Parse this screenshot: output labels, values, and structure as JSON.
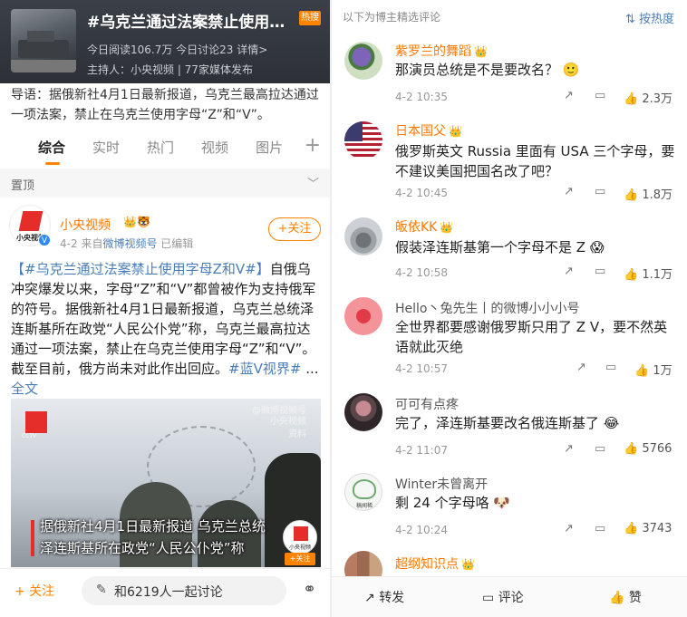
{
  "topic": {
    "title": "#乌克兰通过法案禁止使用字母Z和V#",
    "hot_badge": "热搜",
    "stats": "今日阅读106.7万  今日讨论23  详情>",
    "host": "主持人：小央视频 | 77家媒体发布",
    "intro": "导语：据俄新社4月1日最新报道，乌克兰最高拉达通过一项法案，禁止在乌克兰使用字母“Z”和“V”。"
  },
  "tabs": [
    "综合",
    "实时",
    "热门",
    "视频",
    "图片"
  ],
  "tab_plus": "+",
  "pinned": {
    "label": "置顶",
    "chevron": "﹀"
  },
  "post": {
    "author": "小央视频",
    "author_badges": "👑🐯",
    "avatar_text": "小央视频",
    "verified": "V",
    "date": "4-2",
    "source_prefix": "来自",
    "source": "微博视频号",
    "edited": "已编辑",
    "follow_label": "+关注",
    "hashtag": "【#乌克兰通过法案禁止使用字母Z和V#】",
    "body": "自俄乌冲突爆发以来，字母“Z”和“V”都曾被作为支持俄军的符号。据俄新社4月1日最新报道，乌克兰总统泽连斯基所在政党“人民公仆党”称，乌克兰最高拉达通过一项法案，禁止在乌克兰使用字母“Z”和“V”。截至目前，俄方尚未对此作出回应。",
    "hashtag2": "#蓝V视界#",
    "ellipsis": " ... ",
    "full_text": "全文"
  },
  "video": {
    "logo_text": "CCTV",
    "watermark": "@微博视频号\n小央视频",
    "watermark2": "资料",
    "subtitle_line1": "据俄新社4月1日最新报道 乌克兰总统",
    "subtitle_line2": "泽连斯基所在政党“人民公仆党”称",
    "avatar_text": "小央视频",
    "follow": "+关注"
  },
  "bottom_bar": {
    "follow": "+ 关注",
    "input_icon": "✎",
    "input_text": "和6219人一起讨论",
    "share_icon": "⚭"
  },
  "comments_header": {
    "label": "以下为博主精选评论",
    "sort": "⇅ 按热度"
  },
  "comments": [
    {
      "name": "紫罗兰的舞蹈",
      "crown": "👑",
      "text": "那演员总统是不是要改名？ 🙂",
      "date": "4-2 10:35",
      "likes": "2.3万",
      "name_style": "orange"
    },
    {
      "name": "日本国父",
      "crown": "👑",
      "text": "俄罗斯英文 Russia 里面有 USA 三个字母，要不建议美国把国名改了吧？",
      "date": "4-2 10:45",
      "likes": "1.8万",
      "name_style": "orange"
    },
    {
      "name": "皈依KK",
      "crown": "👑",
      "text": "假装泽连斯基第一个字母不是 Z 😱",
      "date": "4-2 10:58",
      "likes": "1.1万",
      "name_style": "orange"
    },
    {
      "name": "Hello丶兔先生丨的微博小小小号",
      "crown": "",
      "text": "全世界都要感谢俄罗斯只用了 Z V，要不然英语就此灭绝",
      "date": "4-2 10:57",
      "likes": "1万",
      "name_style": "gray"
    },
    {
      "name": "可可有点疼",
      "crown": "",
      "text": "完了，泽连斯基要改名俄连斯基了 😂",
      "date": "4-2 11:07",
      "likes": "5766",
      "name_style": "gray"
    },
    {
      "name": "Winter未曾离开",
      "crown": "",
      "text": "剩 24 个字母咯 🐶",
      "date": "4-2 10:24",
      "likes": "3743",
      "name_style": "gray"
    },
    {
      "name": "超纲知识点",
      "crown": "👑",
      "text": "",
      "date": "",
      "likes": "",
      "name_style": "orange"
    }
  ],
  "comment_icons": {
    "share": "↗",
    "comment": "▭",
    "like": "👍"
  },
  "avatar_labels": {
    "cute": "稿闻稀"
  },
  "right_bottom": {
    "repost": "转发",
    "comment": "评论",
    "like": "赞",
    "repost_icon": "↗",
    "comment_icon": "▭",
    "like_icon": "👍"
  },
  "colors": {
    "accent": "#ff8200",
    "link": "#4a7eb8",
    "name_orange": "#ff7700"
  }
}
